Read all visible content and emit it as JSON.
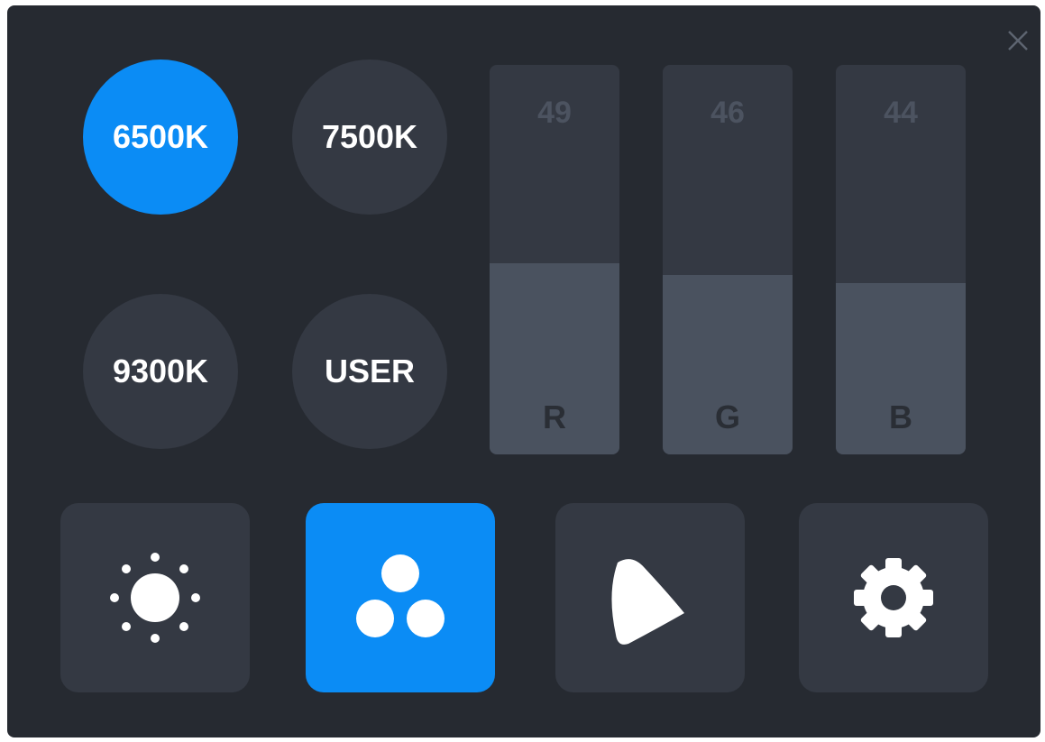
{
  "presets": [
    {
      "label": "6500K",
      "active": true
    },
    {
      "label": "7500K",
      "active": false
    },
    {
      "label": "9300K",
      "active": false
    },
    {
      "label": "USER",
      "active": false
    }
  ],
  "rgb": {
    "channels": [
      {
        "label": "R",
        "value": "49",
        "level": 0.49
      },
      {
        "label": "G",
        "value": "46",
        "level": 0.46
      },
      {
        "label": "B",
        "value": "44",
        "level": 0.44
      }
    ]
  },
  "toolbar": {
    "items": [
      {
        "icon": "brightness-icon",
        "active": false
      },
      {
        "icon": "color-mode-icon",
        "active": true
      },
      {
        "icon": "gamut-icon",
        "active": false
      },
      {
        "icon": "settings-gear-icon",
        "active": false
      }
    ]
  },
  "colors": {
    "accent": "#0b8cf5",
    "panel": "#262a31",
    "tile": "#343943",
    "bar_fill": "#4a525f"
  }
}
